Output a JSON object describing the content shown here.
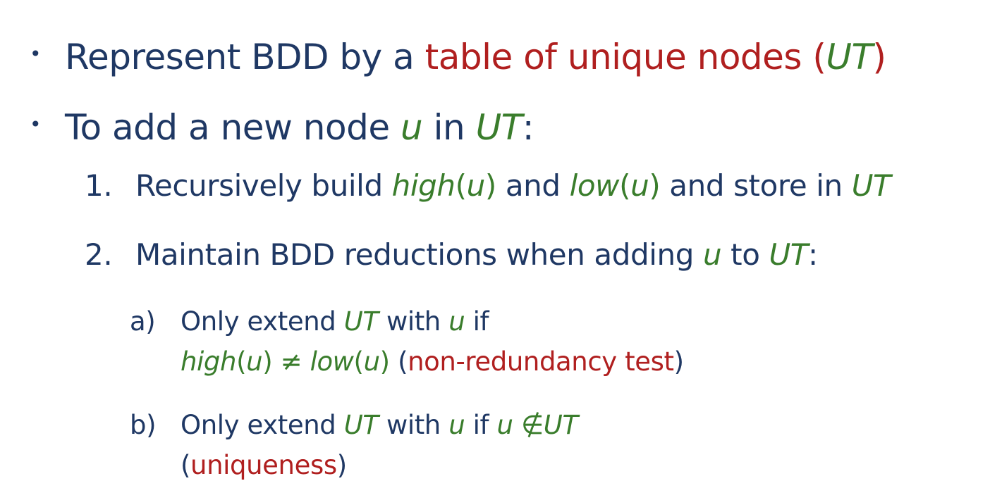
{
  "slide": {
    "bullet1": {
      "marker": "•",
      "text_a": "Represent BDD by a ",
      "text_b": "table of unique nodes (",
      "text_c": "UT",
      "text_d": ")"
    },
    "bullet2": {
      "marker": "•",
      "text_a": "To add a new node ",
      "text_b": "u",
      "text_c": " in ",
      "text_d": "UT",
      "text_e": ":"
    },
    "item1": {
      "number": "1.",
      "t1": "Recursively build ",
      "t2": "high",
      "t3": "(",
      "t4": "u",
      "t5": ")",
      "t6": " and ",
      "t7": "low",
      "t8": "(",
      "t9": "u",
      "t10": ")",
      "t11": " and store in ",
      "t12": "UT"
    },
    "item2": {
      "number": "2.",
      "t1": "Maintain BDD reductions when adding ",
      "t2": "u",
      "t3": " to ",
      "t4": "UT",
      "t5": ":"
    },
    "sub_a": {
      "label": "a)",
      "line1_t1": "Only extend ",
      "line1_t2": "UT",
      "line1_t3": " with ",
      "line1_t4": "u",
      "line1_t5": " if",
      "line2_t1": "high",
      "line2_t2": "(",
      "line2_t3": "u",
      "line2_t4": ")",
      "line2_t5": " ≠ ",
      "line2_t6": "low",
      "line2_t7": "(",
      "line2_t8": "u",
      "line2_t9": ")",
      "line2_t10": " (",
      "line2_t11": "non-redundancy test",
      "line2_t12": ")"
    },
    "sub_b": {
      "label": "b)",
      "line1_t1": "Only extend ",
      "line1_t2": "UT",
      "line1_t3": " with ",
      "line1_t4": "u",
      "line1_t5": " if ",
      "line1_t6": "u",
      "line1_t7": " ∉",
      "line1_t8": "UT",
      "line2_t1": "(",
      "line2_t2": "uniqueness",
      "line2_t3": ")"
    },
    "colors": {
      "text": "#1f3864",
      "emphasis_red": "#b01f1f",
      "emphasis_green": "#3a7d2c"
    }
  }
}
